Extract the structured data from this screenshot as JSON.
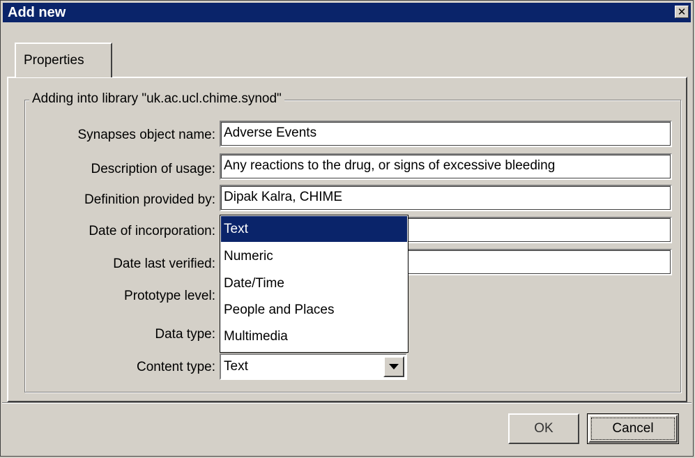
{
  "window": {
    "title": "Add new",
    "close_glyph": "✕"
  },
  "tabs": [
    {
      "label": "Properties",
      "active": true
    }
  ],
  "group": {
    "legend": "Adding into library \"uk.ac.ucl.chime.synod\""
  },
  "fields": {
    "object_name": {
      "label": "Synapses object name:",
      "value": "Adverse Events"
    },
    "description": {
      "label": "Description of usage:",
      "value": "Any reactions to the drug, or signs of excessive bleeding"
    },
    "definition": {
      "label": "Definition provided by:",
      "value": "Dipak Kalra, CHIME"
    },
    "date_incorporation": {
      "label": "Date of incorporation:",
      "value": ""
    },
    "date_verified": {
      "label": "Date last verified:",
      "value": ""
    },
    "prototype_level": {
      "label": "Prototype level:"
    },
    "data_type": {
      "label": "Data type:"
    },
    "content_type": {
      "label": "Content type:",
      "value": "Text"
    }
  },
  "dropdown": {
    "options": [
      "Text",
      "Numeric",
      "Date/Time",
      "People and Places",
      "Multimedia"
    ],
    "selected": "Text"
  },
  "buttons": {
    "ok": "OK",
    "cancel": "Cancel"
  },
  "colors": {
    "titlebar": "#0a246a",
    "dialog_bg": "#d4d0c8",
    "selection": "#0a246a"
  }
}
